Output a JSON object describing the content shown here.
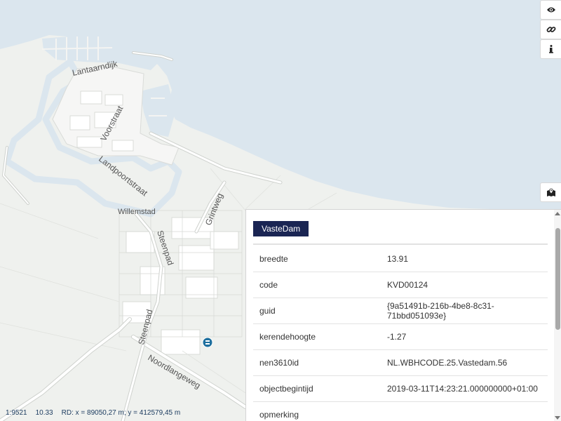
{
  "map": {
    "labels": {
      "lantaarndijk": "Lantaarndijk",
      "voorstraat": "Voorstraat",
      "landpoortstraat": "Landpoortstraat",
      "willemstad": "Willemstad",
      "grintweg": "Grintweg",
      "steenpad_1": "Steenpad",
      "steenpad_2": "Steenpad",
      "noordlangeweg": "Noordlangeweg"
    },
    "colors": {
      "water": "#dbe6ee",
      "land": "#eff1ee",
      "block": "#f8f8f7",
      "road": "#ffffff",
      "road_outline": "#cfd2ce",
      "marker": "#1e6f9e"
    }
  },
  "controls": {
    "top_icons": [
      "eye-icon",
      "link-icon",
      "info-icon"
    ],
    "map_legend_icon": "map-marker-icon"
  },
  "feature_panel": {
    "tab_label": "VasteDam",
    "attributes": [
      {
        "key": "breedte",
        "value": "13.91"
      },
      {
        "key": "code",
        "value": "KVD00124"
      },
      {
        "key": "guid",
        "value": "{9a51491b-216b-4be8-8c31-71bbd051093e}"
      },
      {
        "key": "kerendehoogte",
        "value": "-1.27"
      },
      {
        "key": "nen3610id",
        "value": "NL.WBHCODE.25.Vastedam.56"
      },
      {
        "key": "objectbegintijd",
        "value": "2019-03-11T14:23:21.000000000+01:00"
      },
      {
        "key": "opmerking",
        "value": ""
      }
    ]
  },
  "statusbar": {
    "scale": "1:9521",
    "zoom": "10.33",
    "coords": "RD: x = 89050,27 m; y = 412579,45 m"
  }
}
